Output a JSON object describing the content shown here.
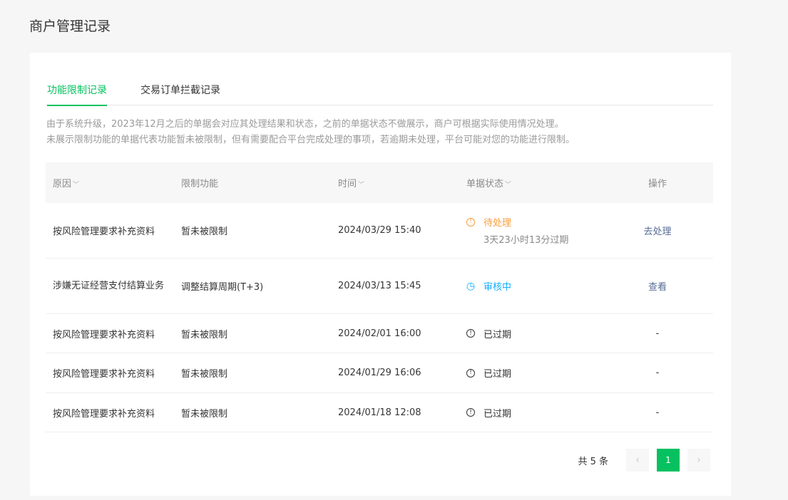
{
  "page_title": "商户管理记录",
  "tabs": [
    {
      "label": "功能限制记录",
      "active": true
    },
    {
      "label": "交易订单拦截记录",
      "active": false
    }
  ],
  "notice": {
    "line1": "由于系统升级，2023年12月之后的单据会对应其处理结果和状态，之前的单据状态不做展示，商户可根据实际使用情况处理。",
    "line2": "未展示限制功能的单据代表功能暂未被限制，但有需要配合平台完成处理的事项，若逾期未处理，平台可能对您的功能进行限制。"
  },
  "table": {
    "headers": [
      "原因",
      "限制功能",
      "时间",
      "单据状态",
      "操作"
    ],
    "rows": [
      {
        "reason": "按风险管理要求补充资料",
        "feature": "暂未被限制",
        "time": "2024/03/29 15:40",
        "status": "待处理",
        "status_icon": "exclamation-circle-icon",
        "status_type": "pending",
        "status_sub": "3天23小时13分过期",
        "action": "去处理"
      },
      {
        "reason": "涉嫌无证经营支付结算业务",
        "feature": "调整结算周期(T+3)",
        "time": "2024/03/13 15:45",
        "status": "审核中",
        "status_icon": "clock-icon",
        "status_type": "review",
        "status_sub": "",
        "action": "查看"
      },
      {
        "reason": "按风险管理要求补充资料",
        "feature": "暂未被限制",
        "time": "2024/02/01 16:00",
        "status": "已过期",
        "status_icon": "exclamation-circle-icon",
        "status_type": "expired",
        "status_sub": "",
        "action": "-"
      },
      {
        "reason": "按风险管理要求补充资料",
        "feature": "暂未被限制",
        "time": "2024/01/29 16:06",
        "status": "已过期",
        "status_icon": "exclamation-circle-icon",
        "status_type": "expired",
        "status_sub": "",
        "action": "-"
      },
      {
        "reason": "按风险管理要求补充资料",
        "feature": "暂未被限制",
        "time": "2024/01/18 12:08",
        "status": "已过期",
        "status_icon": "exclamation-circle-icon",
        "status_type": "expired",
        "status_sub": "",
        "action": "-"
      }
    ]
  },
  "pagination": {
    "total": "共 5 条",
    "current": "1",
    "prev_icon": "chevron-left-icon",
    "next_icon": "chevron-right-icon"
  },
  "colors": {
    "accent": "#07c160",
    "pending": "#fa9d3b",
    "review": "#10aeff",
    "link": "#576b95"
  }
}
